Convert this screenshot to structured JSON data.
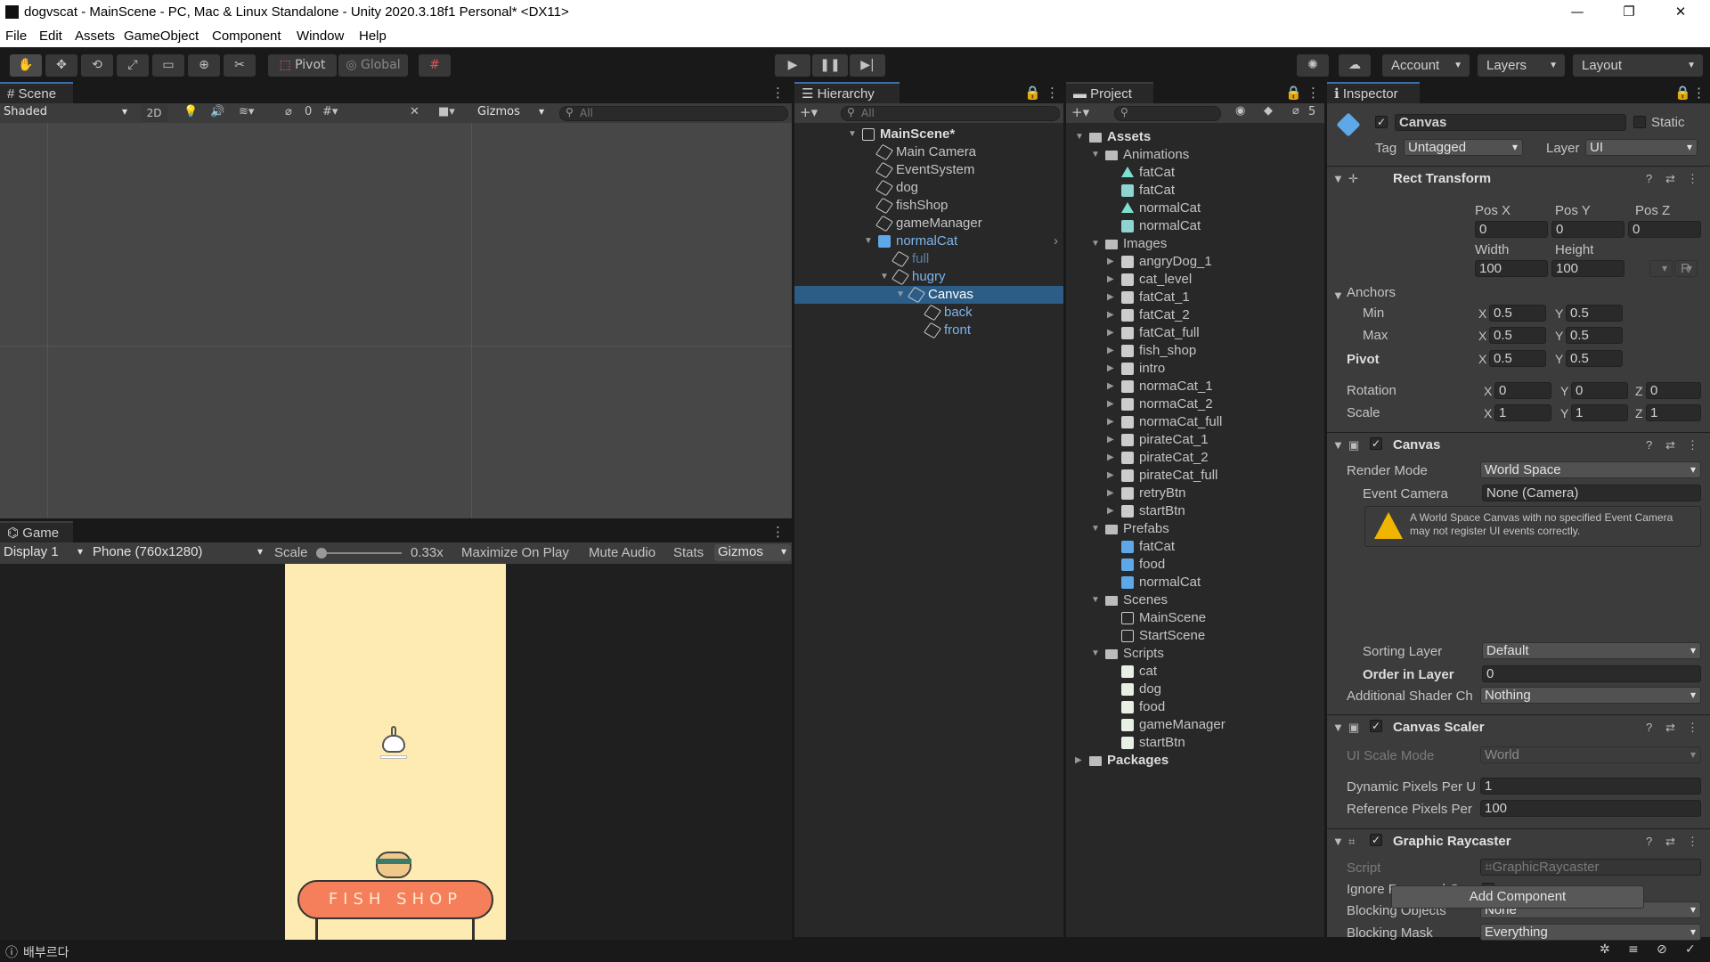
{
  "window": {
    "title": "dogvscat - MainScene - PC, Mac & Linux Standalone - Unity 2020.3.18f1 Personal* <DX11>",
    "minimize": "—",
    "maximize": "❐",
    "close": "✕"
  },
  "menu": [
    "File",
    "Edit",
    "Assets",
    "GameObject",
    "Component",
    "Window",
    "Help"
  ],
  "toolbar": {
    "pivot": "Pivot",
    "global": "Global",
    "account": "Account",
    "layers": "Layers",
    "layout": "Layout"
  },
  "scene": {
    "tab": "Scene",
    "shading": "Shaded",
    "mode2d": "2D",
    "hidden_count": "0",
    "gizmos": "Gizmos",
    "search": "All"
  },
  "game": {
    "tab": "Game",
    "display": "Display 1",
    "resolution": "Phone (760x1280)",
    "scale_label": "Scale",
    "scale_value": "0.33x",
    "maximize": "Maximize On Play",
    "mute": "Mute Audio",
    "stats": "Stats",
    "gizmos": "Gizmos",
    "shop_sign": "FISH SHOP"
  },
  "hierarchy": {
    "tab": "Hierarchy",
    "search": "All",
    "items": [
      {
        "name": "MainScene*",
        "depth": 0,
        "icon": "unity-scene-icon",
        "arrow": "▼",
        "bold": true
      },
      {
        "name": "Main Camera",
        "depth": 1,
        "icon": "gameobject-icon"
      },
      {
        "name": "EventSystem",
        "depth": 1,
        "icon": "gameobject-icon"
      },
      {
        "name": "dog",
        "depth": 1,
        "icon": "gameobject-icon"
      },
      {
        "name": "fishShop",
        "depth": 1,
        "icon": "gameobject-icon"
      },
      {
        "name": "gameManager",
        "depth": 1,
        "icon": "gameobject-icon"
      },
      {
        "name": "normalCat",
        "depth": 1,
        "icon": "prefab-icon",
        "arrow": "▼",
        "color": "#7cb4ec",
        "more": "›"
      },
      {
        "name": "full",
        "depth": 2,
        "icon": "gameobject-icon",
        "color": "#5a7fa8"
      },
      {
        "name": "hugry",
        "depth": 2,
        "icon": "gameobject-icon",
        "arrow": "▼",
        "color": "#7cb4ec"
      },
      {
        "name": "Canvas",
        "depth": 3,
        "icon": "gameobject-icon",
        "arrow": "▼",
        "selected": true
      },
      {
        "name": "back",
        "depth": 4,
        "icon": "gameobject-icon",
        "color": "#7cb4ec"
      },
      {
        "name": "front",
        "depth": 4,
        "icon": "gameobject-icon",
        "color": "#7cb4ec"
      }
    ]
  },
  "project": {
    "tab": "Project",
    "hidden_count": "5",
    "items": [
      {
        "name": "Assets",
        "depth": 0,
        "icon": "folder-icon",
        "arrow": "▼",
        "bold": true
      },
      {
        "name": "Animations",
        "depth": 1,
        "icon": "folder-icon",
        "arrow": "▼"
      },
      {
        "name": "fatCat",
        "depth": 2,
        "icon": "animation-clip-icon"
      },
      {
        "name": "fatCat",
        "depth": 2,
        "icon": "animator-controller-icon"
      },
      {
        "name": "normalCat",
        "depth": 2,
        "icon": "animation-clip-icon"
      },
      {
        "name": "normalCat",
        "depth": 2,
        "icon": "animator-controller-icon"
      },
      {
        "name": "Images",
        "depth": 1,
        "icon": "folder-icon",
        "arrow": "▼"
      },
      {
        "name": "angryDog_1",
        "depth": 2,
        "icon": "image-icon",
        "arrow": "▶"
      },
      {
        "name": "cat_level",
        "depth": 2,
        "icon": "image-icon",
        "arrow": "▶"
      },
      {
        "name": "fatCat_1",
        "depth": 2,
        "icon": "image-icon",
        "arrow": "▶"
      },
      {
        "name": "fatCat_2",
        "depth": 2,
        "icon": "image-icon",
        "arrow": "▶"
      },
      {
        "name": "fatCat_full",
        "depth": 2,
        "icon": "image-icon",
        "arrow": "▶"
      },
      {
        "name": "fish_shop",
        "depth": 2,
        "icon": "image-icon",
        "arrow": "▶"
      },
      {
        "name": "intro",
        "depth": 2,
        "icon": "image-icon",
        "arrow": "▶"
      },
      {
        "name": "normaCat_1",
        "depth": 2,
        "icon": "image-icon",
        "arrow": "▶"
      },
      {
        "name": "normaCat_2",
        "depth": 2,
        "icon": "image-icon",
        "arrow": "▶"
      },
      {
        "name": "normaCat_full",
        "depth": 2,
        "icon": "image-icon",
        "arrow": "▶"
      },
      {
        "name": "pirateCat_1",
        "depth": 2,
        "icon": "image-icon",
        "arrow": "▶"
      },
      {
        "name": "pirateCat_2",
        "depth": 2,
        "icon": "image-icon",
        "arrow": "▶"
      },
      {
        "name": "pirateCat_full",
        "depth": 2,
        "icon": "image-icon",
        "arrow": "▶"
      },
      {
        "name": "retryBtn",
        "depth": 2,
        "icon": "image-icon",
        "arrow": "▶"
      },
      {
        "name": "startBtn",
        "depth": 2,
        "icon": "image-icon",
        "arrow": "▶"
      },
      {
        "name": "Prefabs",
        "depth": 1,
        "icon": "folder-icon",
        "arrow": "▼"
      },
      {
        "name": "fatCat",
        "depth": 2,
        "icon": "prefab-icon"
      },
      {
        "name": "food",
        "depth": 2,
        "icon": "prefab-icon"
      },
      {
        "name": "normalCat",
        "depth": 2,
        "icon": "prefab-icon"
      },
      {
        "name": "Scenes",
        "depth": 1,
        "icon": "folder-icon",
        "arrow": "▼"
      },
      {
        "name": "MainScene",
        "depth": 2,
        "icon": "scene-icon"
      },
      {
        "name": "StartScene",
        "depth": 2,
        "icon": "scene-icon"
      },
      {
        "name": "Scripts",
        "depth": 1,
        "icon": "folder-icon",
        "arrow": "▼"
      },
      {
        "name": "cat",
        "depth": 2,
        "icon": "script-icon"
      },
      {
        "name": "dog",
        "depth": 2,
        "icon": "script-icon"
      },
      {
        "name": "food",
        "depth": 2,
        "icon": "script-icon"
      },
      {
        "name": "gameManager",
        "depth": 2,
        "icon": "gear-script-icon"
      },
      {
        "name": "startBtn",
        "depth": 2,
        "icon": "script-icon"
      },
      {
        "name": "Packages",
        "depth": 0,
        "icon": "folder-icon",
        "arrow": "▶",
        "bold": true
      }
    ]
  },
  "inspector": {
    "tab": "Inspector",
    "object_name": "Canvas",
    "static": "Static",
    "tag_label": "Tag",
    "tag": "Untagged",
    "layer_label": "Layer",
    "layer": "UI",
    "rect": {
      "title": "Rect Transform",
      "posx_l": "Pos X",
      "posy_l": "Pos Y",
      "posz_l": "Pos Z",
      "posx": "0",
      "posy": "0",
      "posz": "0",
      "width_l": "Width",
      "height_l": "Height",
      "width": "100",
      "height": "100",
      "r": "R",
      "anchors": "Anchors",
      "min": "Min",
      "max": "Max",
      "minx": "0.5",
      "miny": "0.5",
      "maxx": "0.5",
      "maxy": "0.5",
      "pivot": "Pivot",
      "pivx": "0.5",
      "pivy": "0.5",
      "rotation": "Rotation",
      "rotx": "0",
      "roty": "0",
      "rotz": "0",
      "scale": "Scale",
      "scx": "1",
      "scy": "1",
      "scz": "1",
      "X": "X",
      "Y": "Y",
      "Z": "Z"
    },
    "canvas": {
      "title": "Canvas",
      "render_mode_l": "Render Mode",
      "render_mode": "World Space",
      "event_camera_l": "Event Camera",
      "event_camera": "None (Camera)",
      "warning": "A World Space Canvas with no specified Event Camera may not register UI events correctly.",
      "sorting_layer_l": "Sorting Layer",
      "sorting_layer": "Default",
      "order_l": "Order in Layer",
      "order": "0",
      "shader_l": "Additional Shader Ch",
      "shader": "Nothing"
    },
    "scaler": {
      "title": "Canvas Scaler",
      "mode_l": "UI Scale Mode",
      "mode": "World",
      "dyn_l": "Dynamic Pixels Per U",
      "dyn": "1",
      "ref_l": "Reference Pixels Per",
      "ref": "100"
    },
    "raycaster": {
      "title": "Graphic Raycaster",
      "script_l": "Script",
      "script": "GraphicRaycaster",
      "ignore_l": "Ignore Reversed Gra",
      "blocking_l": "Blocking Objects",
      "blocking": "None",
      "mask_l": "Blocking Mask",
      "mask": "Everything"
    },
    "add_component": "Add Component"
  },
  "status": {
    "message": "배부르다"
  }
}
